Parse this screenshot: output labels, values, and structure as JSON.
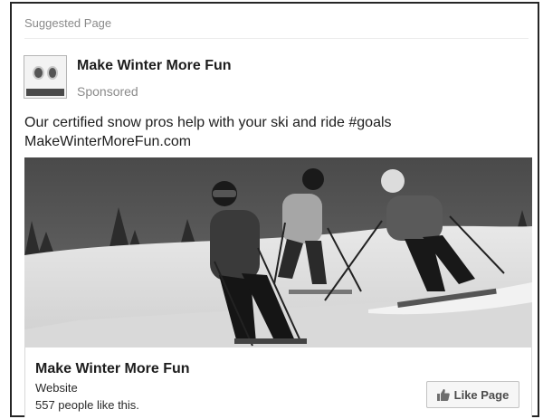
{
  "card": {
    "header_label": "Suggested Page",
    "page_name": "Make Winter More Fun",
    "sponsored_label": "Sponsored",
    "ad_text_line1": "Our certified snow pros help with your ski and ride #goals",
    "ad_text_line2": "MakeWinterMoreFun.com",
    "photo": {
      "icon": "skiers-photo"
    }
  },
  "footer": {
    "page_name": "Make Winter More Fun",
    "page_type": "Website",
    "likes_text": "557 people like this.",
    "like_button_label": "Like Page",
    "like_icon": "thumbs-up-icon"
  }
}
